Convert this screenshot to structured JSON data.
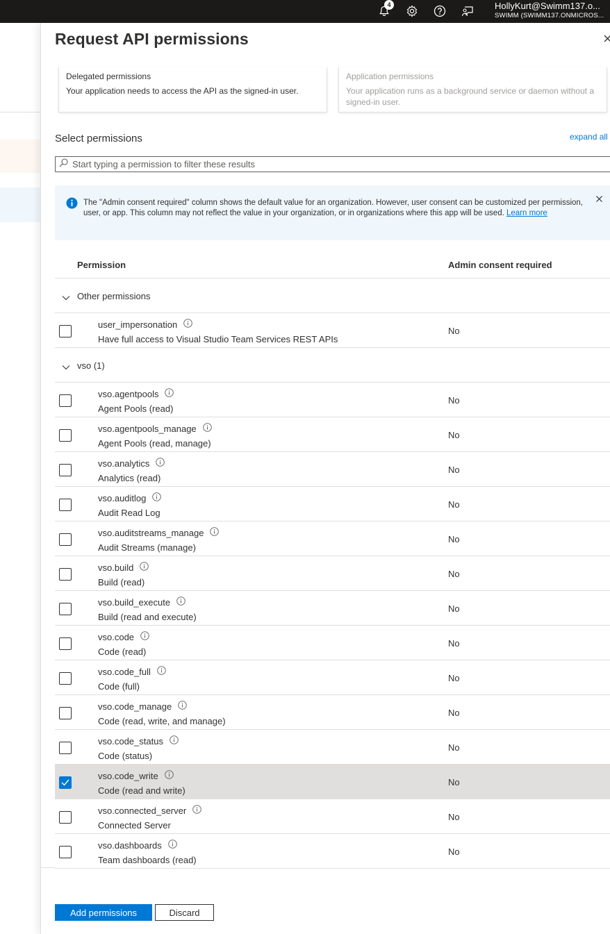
{
  "topbar": {
    "notification_count": "4",
    "user_name": "HollyKurt@Swimm137.o...",
    "user_tenant": "SWIMM (SWIMM137.ONMICROS..."
  },
  "panel": {
    "title": "Request API permissions",
    "delegated": {
      "title": "Delegated permissions",
      "desc": "Your application needs to access the API as the signed-in user."
    },
    "application": {
      "title": "Application permissions",
      "desc": "Your application runs as a background service or daemon without a signed-in user."
    },
    "select_label": "Select permissions",
    "expand_all": "expand all",
    "filter_placeholder": "Start typing a permission to filter these results",
    "info": {
      "text": "The \"Admin consent required\" column shows the default value for an organization. However, user consent can be customized per permission, user, or app. This column may not reflect the value in your organization, or in organizations where this app will be used. ",
      "link": "Learn more"
    },
    "columns": {
      "permission": "Permission",
      "admin_consent": "Admin consent required"
    },
    "groups": {
      "other": "Other permissions",
      "vso": "vso (1)"
    },
    "other_permissions": [
      {
        "name": "user_impersonation",
        "desc": "Have full access to Visual Studio Team Services REST APIs",
        "consent": "No",
        "checked": false
      }
    ],
    "vso_permissions": [
      {
        "name": "vso.agentpools",
        "desc": "Agent Pools (read)",
        "consent": "No",
        "checked": false
      },
      {
        "name": "vso.agentpools_manage",
        "desc": "Agent Pools (read, manage)",
        "consent": "No",
        "checked": false
      },
      {
        "name": "vso.analytics",
        "desc": "Analytics (read)",
        "consent": "No",
        "checked": false
      },
      {
        "name": "vso.auditlog",
        "desc": "Audit Read Log",
        "consent": "No",
        "checked": false
      },
      {
        "name": "vso.auditstreams_manage",
        "desc": "Audit Streams (manage)",
        "consent": "No",
        "checked": false
      },
      {
        "name": "vso.build",
        "desc": "Build (read)",
        "consent": "No",
        "checked": false
      },
      {
        "name": "vso.build_execute",
        "desc": "Build (read and execute)",
        "consent": "No",
        "checked": false
      },
      {
        "name": "vso.code",
        "desc": "Code (read)",
        "consent": "No",
        "checked": false
      },
      {
        "name": "vso.code_full",
        "desc": "Code (full)",
        "consent": "No",
        "checked": false
      },
      {
        "name": "vso.code_manage",
        "desc": "Code (read, write, and manage)",
        "consent": "No",
        "checked": false
      },
      {
        "name": "vso.code_status",
        "desc": "Code (status)",
        "consent": "No",
        "checked": false
      },
      {
        "name": "vso.code_write",
        "desc": "Code (read and write)",
        "consent": "No",
        "checked": true
      },
      {
        "name": "vso.connected_server",
        "desc": "Connected Server",
        "consent": "No",
        "checked": false
      },
      {
        "name": "vso.dashboards",
        "desc": "Team dashboards (read)",
        "consent": "No",
        "checked": false
      }
    ],
    "buttons": {
      "add": "Add permissions",
      "discard": "Discard"
    }
  },
  "colors": {
    "accent": "#0078d4",
    "topbar": "#1b1a19",
    "info_bg": "#eff6fc",
    "selected_row": "#e1dfdd"
  }
}
